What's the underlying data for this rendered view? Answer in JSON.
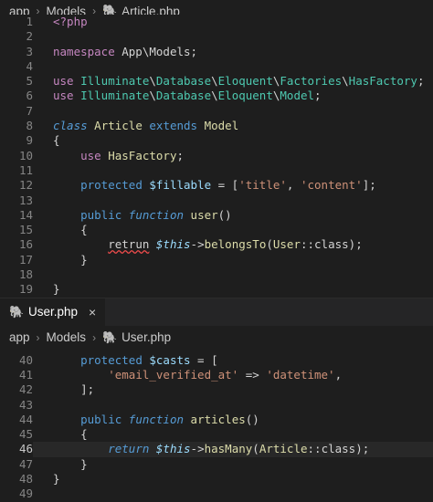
{
  "top": {
    "breadcrumb": {
      "app": "app",
      "models": "Models",
      "file": "Article.php"
    },
    "lines": [
      {
        "n": "1",
        "tokens": [
          [
            "ctl",
            "<?php"
          ]
        ]
      },
      {
        "n": "2",
        "tokens": []
      },
      {
        "n": "3",
        "tokens": [
          [
            "ctl",
            "namespace"
          ],
          [
            "plain",
            " App\\Models;"
          ]
        ]
      },
      {
        "n": "4",
        "tokens": []
      },
      {
        "n": "5",
        "tokens": [
          [
            "ctl",
            "use"
          ],
          [
            "plain",
            " "
          ],
          [
            "typ",
            "Illuminate"
          ],
          [
            "plain",
            "\\"
          ],
          [
            "typ",
            "Database"
          ],
          [
            "plain",
            "\\"
          ],
          [
            "typ",
            "Eloquent"
          ],
          [
            "plain",
            "\\"
          ],
          [
            "typ",
            "Factories"
          ],
          [
            "plain",
            "\\"
          ],
          [
            "typ",
            "HasFactory"
          ],
          [
            "plain",
            ";"
          ]
        ]
      },
      {
        "n": "6",
        "tokens": [
          [
            "ctl",
            "use"
          ],
          [
            "plain",
            " "
          ],
          [
            "typ",
            "Illuminate"
          ],
          [
            "plain",
            "\\"
          ],
          [
            "typ",
            "Database"
          ],
          [
            "plain",
            "\\"
          ],
          [
            "typ",
            "Eloquent"
          ],
          [
            "plain",
            "\\"
          ],
          [
            "typ",
            "Model"
          ],
          [
            "plain",
            ";"
          ]
        ]
      },
      {
        "n": "7",
        "tokens": []
      },
      {
        "n": "8",
        "tokens": [
          [
            "kwi",
            "class"
          ],
          [
            "plain",
            " "
          ],
          [
            "cls",
            "Article"
          ],
          [
            "plain",
            " "
          ],
          [
            "kw",
            "extends"
          ],
          [
            "plain",
            " "
          ],
          [
            "cls",
            "Model"
          ]
        ]
      },
      {
        "n": "9",
        "tokens": [
          [
            "plain",
            "{"
          ]
        ]
      },
      {
        "n": "10",
        "tokens": [
          [
            "plain",
            "    "
          ],
          [
            "ctl",
            "use"
          ],
          [
            "plain",
            " "
          ],
          [
            "cls",
            "HasFactory"
          ],
          [
            "plain",
            ";"
          ]
        ]
      },
      {
        "n": "11",
        "tokens": []
      },
      {
        "n": "12",
        "tokens": [
          [
            "plain",
            "    "
          ],
          [
            "kw",
            "protected"
          ],
          [
            "plain",
            " "
          ],
          [
            "var",
            "$fillable"
          ],
          [
            "plain",
            " = ["
          ],
          [
            "str",
            "'title'"
          ],
          [
            "plain",
            ", "
          ],
          [
            "str",
            "'content'"
          ],
          [
            "plain",
            "];"
          ]
        ]
      },
      {
        "n": "13",
        "tokens": []
      },
      {
        "n": "14",
        "tokens": [
          [
            "plain",
            "    "
          ],
          [
            "kw",
            "public"
          ],
          [
            "plain",
            " "
          ],
          [
            "kwi",
            "function"
          ],
          [
            "plain",
            " "
          ],
          [
            "fn",
            "user"
          ],
          [
            "plain",
            "()"
          ]
        ]
      },
      {
        "n": "15",
        "tokens": [
          [
            "plain",
            "    {"
          ]
        ]
      },
      {
        "n": "16",
        "tokens": [
          [
            "plain",
            "        "
          ],
          [
            "sq",
            "retrun"
          ],
          [
            "plain",
            " "
          ],
          [
            "thisv",
            "$this"
          ],
          [
            "plain",
            "->"
          ],
          [
            "fn",
            "belongsTo"
          ],
          [
            "plain",
            "("
          ],
          [
            "cls",
            "User"
          ],
          [
            "plain",
            "::class);"
          ]
        ],
        "squiggle": true
      },
      {
        "n": "17",
        "tokens": [
          [
            "plain",
            "    }"
          ]
        ]
      },
      {
        "n": "18",
        "tokens": []
      },
      {
        "n": "19",
        "tokens": [
          [
            "plain",
            "}"
          ]
        ]
      }
    ]
  },
  "tab": {
    "label": "User.php",
    "close": "×"
  },
  "bottom": {
    "breadcrumb": {
      "app": "app",
      "models": "Models",
      "file": "User.php"
    },
    "lines": [
      {
        "n": "40",
        "tokens": [
          [
            "plain",
            "    "
          ],
          [
            "kw",
            "protected"
          ],
          [
            "plain",
            " "
          ],
          [
            "var",
            "$casts"
          ],
          [
            "plain",
            " = ["
          ]
        ]
      },
      {
        "n": "41",
        "tokens": [
          [
            "plain",
            "        "
          ],
          [
            "str",
            "'email_verified_at'"
          ],
          [
            "plain",
            " => "
          ],
          [
            "str",
            "'datetime'"
          ],
          [
            "plain",
            ","
          ]
        ]
      },
      {
        "n": "42",
        "tokens": [
          [
            "plain",
            "    ];"
          ]
        ]
      },
      {
        "n": "43",
        "tokens": []
      },
      {
        "n": "44",
        "tokens": [
          [
            "plain",
            "    "
          ],
          [
            "kw",
            "public"
          ],
          [
            "plain",
            " "
          ],
          [
            "kwi",
            "function"
          ],
          [
            "plain",
            " "
          ],
          [
            "fn",
            "articles"
          ],
          [
            "plain",
            "()"
          ]
        ]
      },
      {
        "n": "45",
        "tokens": [
          [
            "plain",
            "    {"
          ]
        ]
      },
      {
        "n": "46",
        "tokens": [
          [
            "plain",
            "        "
          ],
          [
            "kwi",
            "return"
          ],
          [
            "plain",
            " "
          ],
          [
            "thisv",
            "$this"
          ],
          [
            "plain",
            "->"
          ],
          [
            "fn",
            "hasMany"
          ],
          [
            "plain",
            "("
          ],
          [
            "cls",
            "Article"
          ],
          [
            "plain",
            "::class);"
          ]
        ],
        "current": true
      },
      {
        "n": "47",
        "tokens": [
          [
            "plain",
            "    }"
          ]
        ]
      },
      {
        "n": "48",
        "tokens": [
          [
            "plain",
            "}"
          ]
        ]
      },
      {
        "n": "49",
        "tokens": []
      }
    ]
  },
  "colors": {
    "background": "#1e1e1e",
    "php_icon": "#a074c4",
    "error_squiggle": "#f14c4c"
  }
}
